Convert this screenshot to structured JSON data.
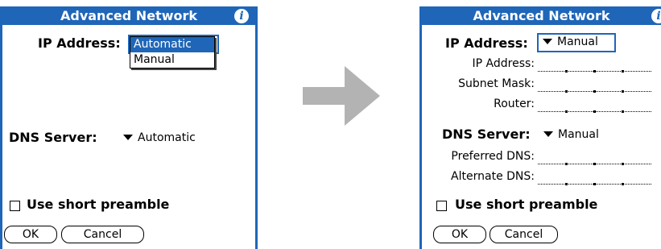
{
  "left": {
    "title": "Advanced Network",
    "ip_address_label": "IP Address:",
    "ip_popup_options": [
      "Automatic",
      "Manual"
    ],
    "ip_popup_selected": "Automatic",
    "dns_server_label": "DNS Server:",
    "dns_server_value": "Automatic",
    "preamble_label": "Use short preamble",
    "ok_label": "OK",
    "cancel_label": "Cancel"
  },
  "right": {
    "title": "Advanced Network",
    "ip_address_label": "IP Address:",
    "ip_address_value": "Manual",
    "fields": {
      "ip_address": "IP Address:",
      "subnet_mask": "Subnet Mask:",
      "router": "Router:"
    },
    "dns_server_label": "DNS Server:",
    "dns_server_value": "Manual",
    "dns_fields": {
      "preferred": "Preferred DNS:",
      "alternate": "Alternate DNS:"
    },
    "preamble_label": "Use short preamble",
    "ok_label": "OK",
    "cancel_label": "Cancel"
  },
  "icons": {
    "info": "info-icon",
    "arrow": "right-arrow-icon",
    "dropdown": "triangle-down-icon"
  },
  "colors": {
    "accent": "#1f66b8",
    "arrow": "#b3b3b3"
  }
}
